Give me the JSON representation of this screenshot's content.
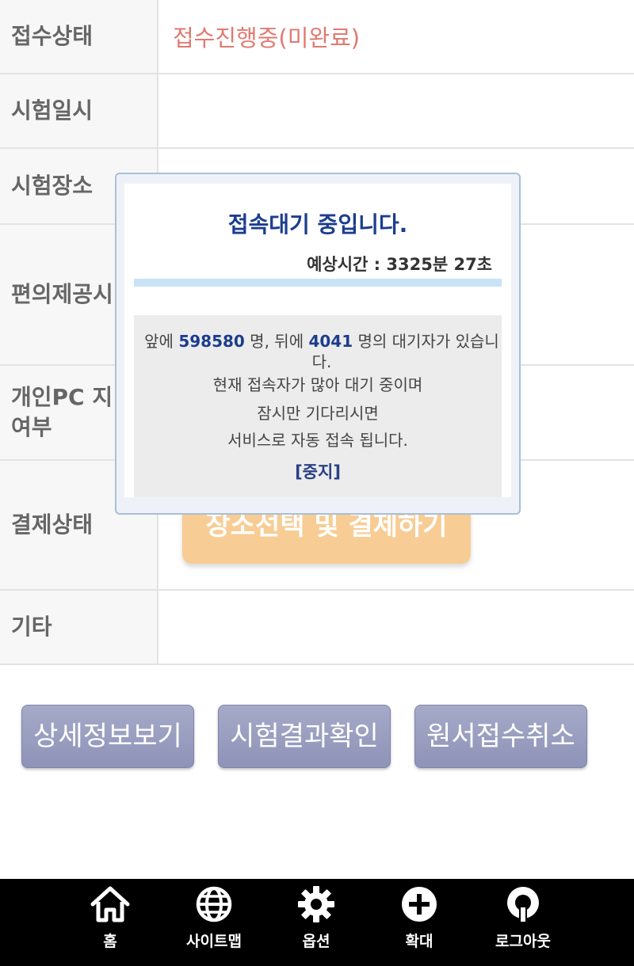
{
  "table": {
    "rows": [
      {
        "label": "접수상태",
        "value": "접수진행중(미완료)"
      },
      {
        "label": "시험일시",
        "value": ""
      },
      {
        "label": "시험장소",
        "value": ""
      },
      {
        "label": "편의제공시",
        "value": ""
      },
      {
        "label": "개인PC 지\n여부",
        "value": ""
      },
      {
        "label": "결제상태",
        "value": ""
      },
      {
        "label": "기타",
        "value": ""
      }
    ],
    "pay_button": "장소선택 및 결제하기"
  },
  "actions": {
    "detail": "상세정보보기",
    "result": "시험결과확인",
    "cancel": "원서접수취소"
  },
  "modal": {
    "title": "접속대기 중입니다.",
    "eta_label": "예상시간 : ",
    "eta_value": "3325분 27초",
    "queue_front_prefix": "앞에 ",
    "queue_front": "598580",
    "queue_mid": " 명, 뒤에 ",
    "queue_back": "4041",
    "queue_suffix": " 명의 대기자가 있습니다.",
    "message_1": "현재 접속자가 많아 대기 중이며",
    "message_2": "잠시만 기다리시면",
    "message_3": "서비스로 자동 접속 됩니다.",
    "stop": "[중지]",
    "progress": 0
  },
  "nav": {
    "home": "홈",
    "sitemap": "사이트맵",
    "options": "옵션",
    "zoom": "확대",
    "logout": "로그아웃"
  },
  "colors": {
    "status": "#e07a72",
    "modal_title": "#1c3d8e",
    "action_button": "#9599bd",
    "pay_button": "#f7cd95",
    "nav_background": "#000000"
  }
}
